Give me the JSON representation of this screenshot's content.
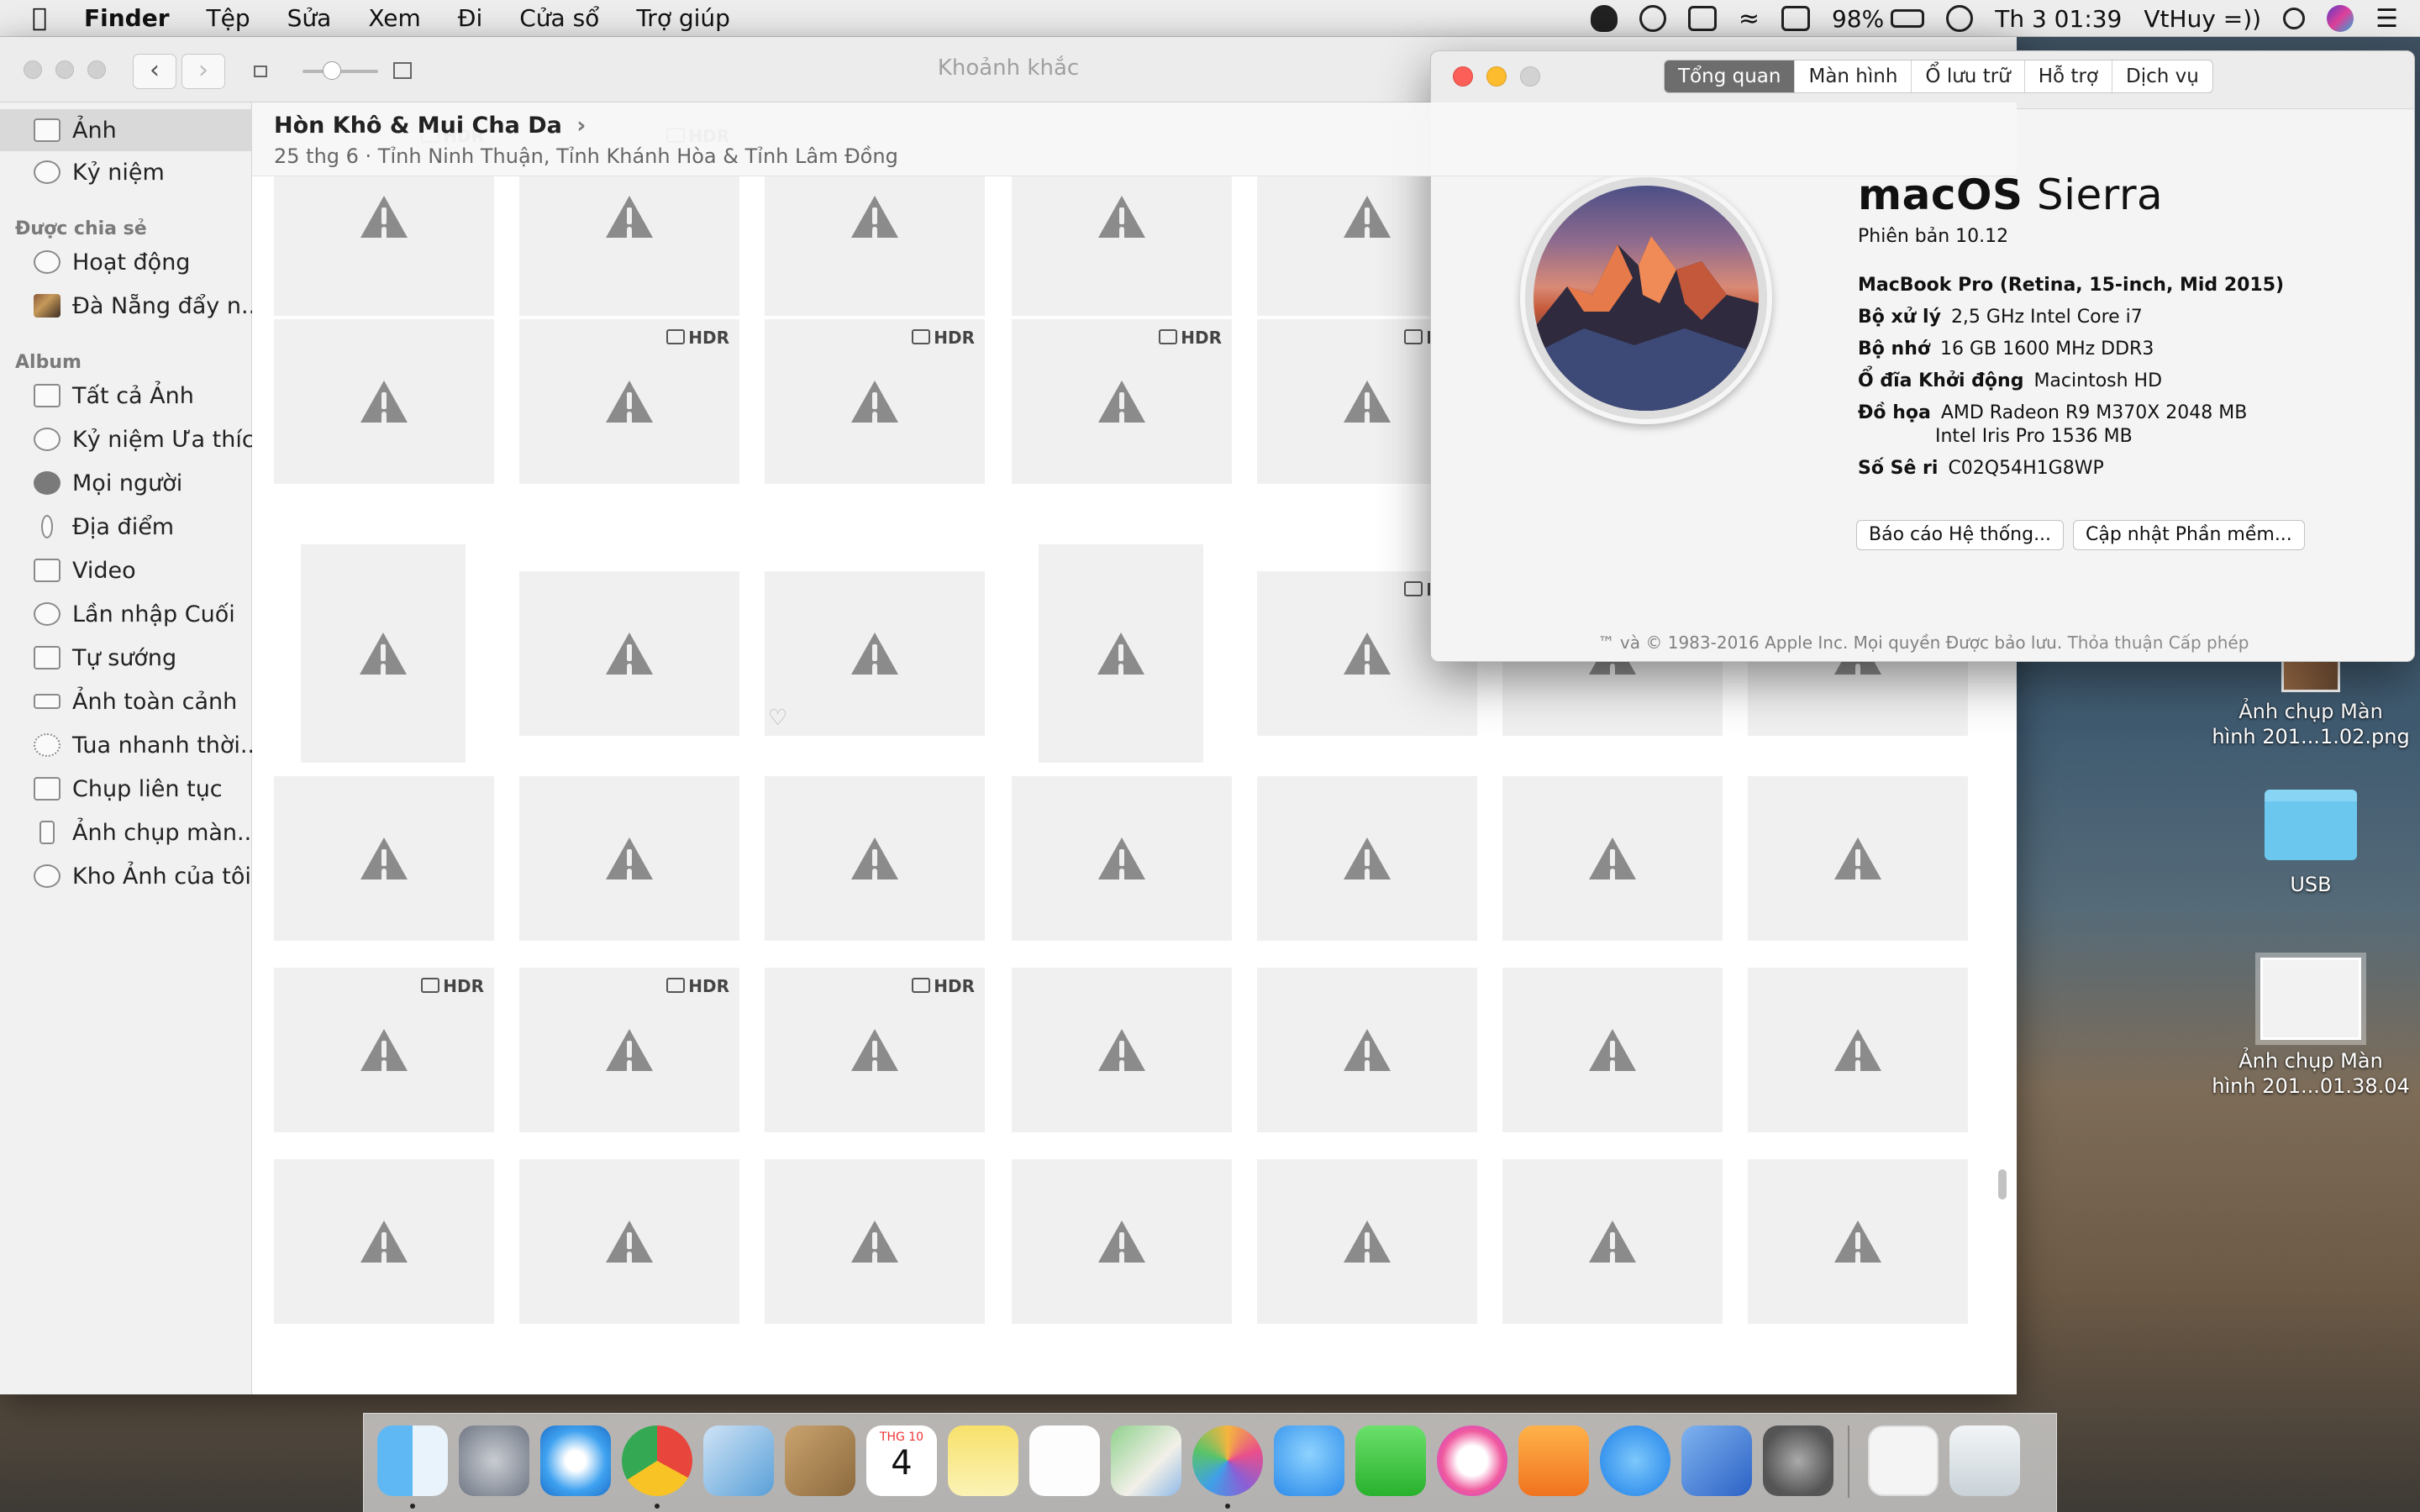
{
  "menubar": {
    "app": "Finder",
    "menus": [
      "Tệp",
      "Sửa",
      "Xem",
      "Đi",
      "Cửa sổ",
      "Trợ giúp"
    ],
    "battery": "98%",
    "clock": "Th 3 01:39",
    "user": "VtHuy =))"
  },
  "photos": {
    "title": "Khoảnh khắc",
    "sidebar": {
      "top": [
        {
          "label": "Ảnh",
          "icon": "photos-icon",
          "selected": true
        },
        {
          "label": "Kỷ niệm",
          "icon": "memories-icon"
        }
      ],
      "shared_header": "Được chia sẻ",
      "shared": [
        {
          "label": "Hoạt động",
          "icon": "cloud-icon"
        },
        {
          "label": "Đà Nẵng đẩy n...",
          "icon": "album-thumbnail"
        }
      ],
      "album_header": "Album",
      "albums": [
        {
          "label": "Tất cả Ảnh",
          "icon": "album-icon"
        },
        {
          "label": "Kỷ niệm Ưa thích",
          "icon": "heart-memories-icon"
        },
        {
          "label": "Mọi người",
          "icon": "person-icon"
        },
        {
          "label": "Địa điểm",
          "icon": "pin-icon"
        },
        {
          "label": "Video",
          "icon": "video-icon"
        },
        {
          "label": "Lần nhập Cuối",
          "icon": "clock-icon"
        },
        {
          "label": "Tự sướng",
          "icon": "camera-icon"
        },
        {
          "label": "Ảnh toàn cảnh",
          "icon": "panorama-icon"
        },
        {
          "label": "Tua nhanh thời...",
          "icon": "timelapse-icon"
        },
        {
          "label": "Chụp liên tục",
          "icon": "burst-icon"
        },
        {
          "label": "Ảnh chụp màn...",
          "icon": "screenshot-icon"
        },
        {
          "label": "Kho Ảnh của tôi",
          "icon": "cloud-icon"
        }
      ]
    },
    "moment": {
      "title": "Hòn Khô & Mui Cha Da",
      "subtitle": "25 thg 6  ·  Tỉnh Ninh Thuận, Tỉnh Khánh Hòa & Tỉnh Lâm Đồng"
    },
    "hdr_label": "HDR"
  },
  "about": {
    "tabs": [
      "Tổng quan",
      "Màn hình",
      "Ổ lưu trữ",
      "Hỗ trợ",
      "Dịch vụ"
    ],
    "os_bold": "macOS",
    "os_name": "Sierra",
    "version": "Phiên bản 10.12",
    "model": "MacBook Pro (Retina, 15-inch, Mid 2015)",
    "specs": [
      {
        "key": "Bộ xử lý",
        "value": "2,5 GHz Intel Core i7"
      },
      {
        "key": "Bộ nhớ",
        "value": "16 GB 1600 MHz DDR3"
      },
      {
        "key": "Ổ đĩa Khởi động",
        "value": "Macintosh HD"
      },
      {
        "key": "Đồ họa",
        "value": "AMD Radeon R9 M370X 2048 MB"
      },
      {
        "key": "",
        "value": "Intel Iris Pro 1536 MB"
      },
      {
        "key": "Số Sê ri",
        "value": "C02Q54H1G8WP"
      }
    ],
    "btn_report": "Báo cáo Hệ thống...",
    "btn_update": "Cập nhật Phần mềm...",
    "legal": "™ và © 1983-2016 Apple Inc. Mọi quyền Được bảo lưu.",
    "license": "Thỏa thuận Cấp phép"
  },
  "desktop": {
    "icon1_line1": "Ảnh chụp Màn",
    "icon1_line2": "hình 201...1.02.png",
    "icon2": "USB",
    "icon3_line1": "Ảnh chụp Màn",
    "icon3_line2": "hình 201...01.38.04"
  },
  "dock": {
    "calendar_month": "THG 10",
    "calendar_day": "4",
    "apps": [
      "Finder",
      "Launchpad",
      "Safari",
      "Chrome",
      "Mail",
      "Contacts",
      "Calendar",
      "Notes",
      "Reminders",
      "Maps",
      "Photos",
      "Messages",
      "FaceTime",
      "iTunes",
      "iBooks",
      "App Store",
      "Keynote",
      "System Preferences",
      "Preview",
      "Trash"
    ]
  }
}
